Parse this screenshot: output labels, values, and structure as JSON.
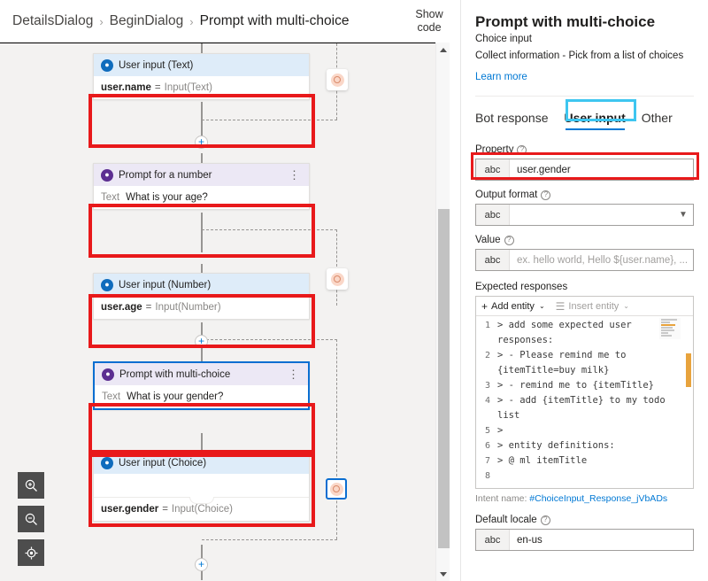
{
  "breadcrumb": {
    "items": [
      "DetailsDialog",
      "BeginDialog",
      "Prompt with multi-choice"
    ],
    "separator": "›"
  },
  "toolbar": {
    "show_code_label": "Show\ncode"
  },
  "canvas": {
    "nodes": [
      {
        "id": "user-input-text",
        "kind": "user",
        "title": "User input (Text)",
        "icon": "person-icon",
        "body_type": "assignment",
        "key": "user.name",
        "eq": "=",
        "value": "Input(Text)",
        "highlighted": true,
        "selected": false,
        "has_menu": false
      },
      {
        "id": "prompt-for-a-number",
        "kind": "prompt",
        "title": "Prompt for a number",
        "icon": "prompt-icon",
        "body_type": "labeled",
        "label": "Text",
        "text": "What is your age?",
        "highlighted": true,
        "selected": false,
        "has_menu": true
      },
      {
        "id": "user-input-number",
        "kind": "user",
        "title": "User input (Number)",
        "icon": "person-icon",
        "body_type": "assignment",
        "key": "user.age",
        "eq": "=",
        "value": "Input(Number)",
        "highlighted": true,
        "selected": false,
        "has_menu": false
      },
      {
        "id": "prompt-with-multi-choice",
        "kind": "prompt",
        "title": "Prompt with multi-choice",
        "icon": "prompt-icon",
        "body_type": "labeled",
        "label": "Text",
        "text": "What is your gender?",
        "highlighted": true,
        "selected": true,
        "has_menu": true
      },
      {
        "id": "user-input-choice",
        "kind": "user",
        "title": "User input (Choice)",
        "icon": "person-icon",
        "body_type": "assignment-with-blank",
        "key": "user.gender",
        "eq": "=",
        "value": "Input(Choice)",
        "highlighted": true,
        "selected": false,
        "has_menu": false
      }
    ],
    "add_node_label": "+",
    "stop_badges": 3,
    "zoom_controls": [
      {
        "name": "zoom-in-icon",
        "label": "Zoom in"
      },
      {
        "name": "zoom-out-icon",
        "label": "Zoom out"
      },
      {
        "name": "zoom-fit-icon",
        "label": "Fit to screen"
      }
    ]
  },
  "panel": {
    "title": "Prompt with multi-choice",
    "subtitle": "Choice input",
    "description": "Collect information - Pick from a list of choices",
    "learn_more": "Learn more",
    "tabs": [
      {
        "label": "Bot response",
        "active": false
      },
      {
        "label": "User input",
        "active": true
      },
      {
        "label": "Other",
        "active": false
      }
    ],
    "fields": [
      {
        "label": "Property",
        "tag": "abc",
        "value": "user.gender",
        "placeholder": "",
        "highlighted": true,
        "has_dropdown": false
      },
      {
        "label": "Output format",
        "tag": "abc",
        "value": "",
        "placeholder": "",
        "highlighted": false,
        "has_dropdown": true
      },
      {
        "label": "Value",
        "tag": "abc",
        "value": "",
        "placeholder": "ex. hello world, Hello ${user.name}, ...",
        "highlighted": false,
        "has_dropdown": false
      }
    ],
    "expected_responses": {
      "label": "Expected responses",
      "toolbar": [
        {
          "label": "Add entity",
          "icon": "plus-icon",
          "caret": "⌄",
          "disabled": false
        },
        {
          "label": "Insert entity",
          "icon": "insert-entity-icon",
          "caret": "⌄",
          "disabled": true
        }
      ],
      "code_lines": [
        {
          "n": "1",
          "text": "> add some expected user responses:",
          "squiggle": false
        },
        {
          "n": "2",
          "text": "> - Please remind me to {itemTitle=buy milk}",
          "squiggle": true
        },
        {
          "n": "3",
          "text": "> - remind me to {itemTitle}",
          "squiggle": false
        },
        {
          "n": "4",
          "text": "> - add {itemTitle} to my todo list",
          "squiggle": false
        },
        {
          "n": "5",
          "text": ">",
          "squiggle": false
        },
        {
          "n": "6",
          "text": "> entity definitions:",
          "squiggle": false
        },
        {
          "n": "7",
          "text": "> @ ml itemTitle",
          "squiggle": false
        },
        {
          "n": "8",
          "text": "",
          "squiggle": false
        }
      ]
    },
    "intent": {
      "prefix": "Intent name:",
      "value": "#ChoiceInput_Response_jVbADs"
    },
    "default_locale": {
      "label": "Default locale",
      "tag": "abc",
      "value": "en-us"
    }
  },
  "colors": {
    "accent": "#0078d4",
    "highlight_red": "#e8191b",
    "highlight_cyan": "#3ec6f0",
    "user_node_header": "#deecf9",
    "prompt_node_header": "#ece8f5",
    "selection_blue": "#0a6ed1"
  }
}
